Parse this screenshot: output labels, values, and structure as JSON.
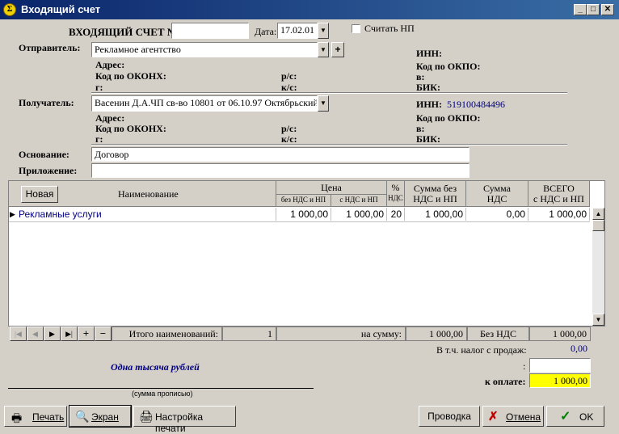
{
  "window": {
    "title": "Входящий счет",
    "minimize": "_",
    "maximize": "□",
    "close": "✕"
  },
  "header": {
    "doc_label": "ВХОДЯЩИЙ СЧЕТ №",
    "doc_number": "",
    "date_label": "Дата:",
    "date_value": "17.02.01",
    "calc_np_label": "Считать НП"
  },
  "sender": {
    "label": "Отправитель:",
    "value": "Рекламное агентство",
    "address_label": "Адрес:",
    "okonh_label": "Код по ОКОНХ:",
    "g_label": "г:",
    "rs_label": "р/с:",
    "ks_label": "к/с:",
    "inn_label": "ИНН:",
    "inn_value": "",
    "okpo_label": "Код по ОКПО:",
    "v_label": "в:",
    "bik_label": "БИК:"
  },
  "recipient": {
    "label": "Получатель:",
    "value": "Васенин Д.А.ЧП св-во 10801 от 06.10.97 Октябрьский",
    "address_label": "Адрес:",
    "okonh_label": "Код по ОКОНХ:",
    "g_label": "г:",
    "rs_label": "р/с:",
    "ks_label": "к/с:",
    "inn_label": "ИНН:",
    "inn_value": "519100484496",
    "okpo_label": "Код по ОКПО:",
    "v_label": "в:",
    "bik_label": "БИК:"
  },
  "basis": {
    "label": "Основание:",
    "value": "Договор"
  },
  "attachment": {
    "label": "Приложение:",
    "value": ""
  },
  "table": {
    "new_button": "Новая",
    "col_name": "Наименование",
    "col_price": "Цена",
    "col_price_no_vat": "без НДС и НП",
    "col_price_vat": "с НДС и НП",
    "col_pct": "%",
    "col_pct_sub": "НДС",
    "col_sum_no_vat_1": "Сумма без",
    "col_sum_no_vat_2": "НДС и НП",
    "col_sum_vat_1": "Сумма",
    "col_sum_vat_2": "НДС",
    "col_total_1": "ВСЕГО",
    "col_total_2": "с НДС и НП",
    "rows": [
      {
        "name": "Рекламные услуги",
        "price_no_vat": "1 000,00",
        "price_vat": "1 000,00",
        "pct": "20",
        "sum_no_vat": "1 000,00",
        "sum_vat": "0,00",
        "total": "1 000,00"
      }
    ]
  },
  "footer": {
    "items_label": "Итого наименований:",
    "items_count": "1",
    "sum_label": "на сумму:",
    "sum_value": "1 000,00",
    "no_vat_label": "Без НДС",
    "total_value": "1 000,00",
    "sales_tax_label": "В т.ч. налог с продаж:",
    "sales_tax_value": "0,00",
    "colon": ":",
    "extra_value": "",
    "to_pay_label": "к оплате:",
    "to_pay_value": "1 000,00",
    "amount_words": "Одна тысяча  рублей",
    "amount_words_caption": "(сумма прописью)"
  },
  "buttons": {
    "print": "Печать",
    "screen": "Экран",
    "print_settings": "Настройка печати",
    "post": "Проводка",
    "cancel": "Отмена",
    "ok": "OK"
  },
  "colors": {
    "titlebar": "#0a246a",
    "inn_value": "#000080",
    "amount_words": "#000080",
    "to_pay_bg": "#ffff00"
  }
}
